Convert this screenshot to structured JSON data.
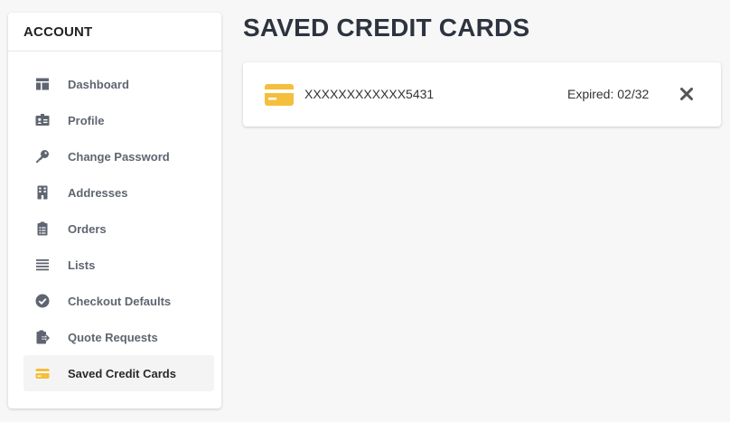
{
  "sidebar": {
    "title": "ACCOUNT",
    "items": [
      {
        "label": "Dashboard",
        "icon": "dashboard-icon"
      },
      {
        "label": "Profile",
        "icon": "id-card-icon"
      },
      {
        "label": "Change Password",
        "icon": "key-icon"
      },
      {
        "label": "Addresses",
        "icon": "building-icon"
      },
      {
        "label": "Orders",
        "icon": "clipboard-list-icon"
      },
      {
        "label": "Lists",
        "icon": "list-icon"
      },
      {
        "label": "Checkout Defaults",
        "icon": "check-circle-icon"
      },
      {
        "label": "Quote Requests",
        "icon": "clipboard-arrow-icon"
      },
      {
        "label": "Saved Credit Cards",
        "icon": "credit-card-icon",
        "active": true
      }
    ]
  },
  "main": {
    "title": "SAVED CREDIT CARDS",
    "cards": [
      {
        "number": "XXXXXXXXXXXX5431",
        "expiry": "Expired: 02/32"
      }
    ]
  },
  "colors": {
    "accent": "#f5be3c",
    "icon_gray": "#5f6570",
    "title": "#2d3440"
  }
}
